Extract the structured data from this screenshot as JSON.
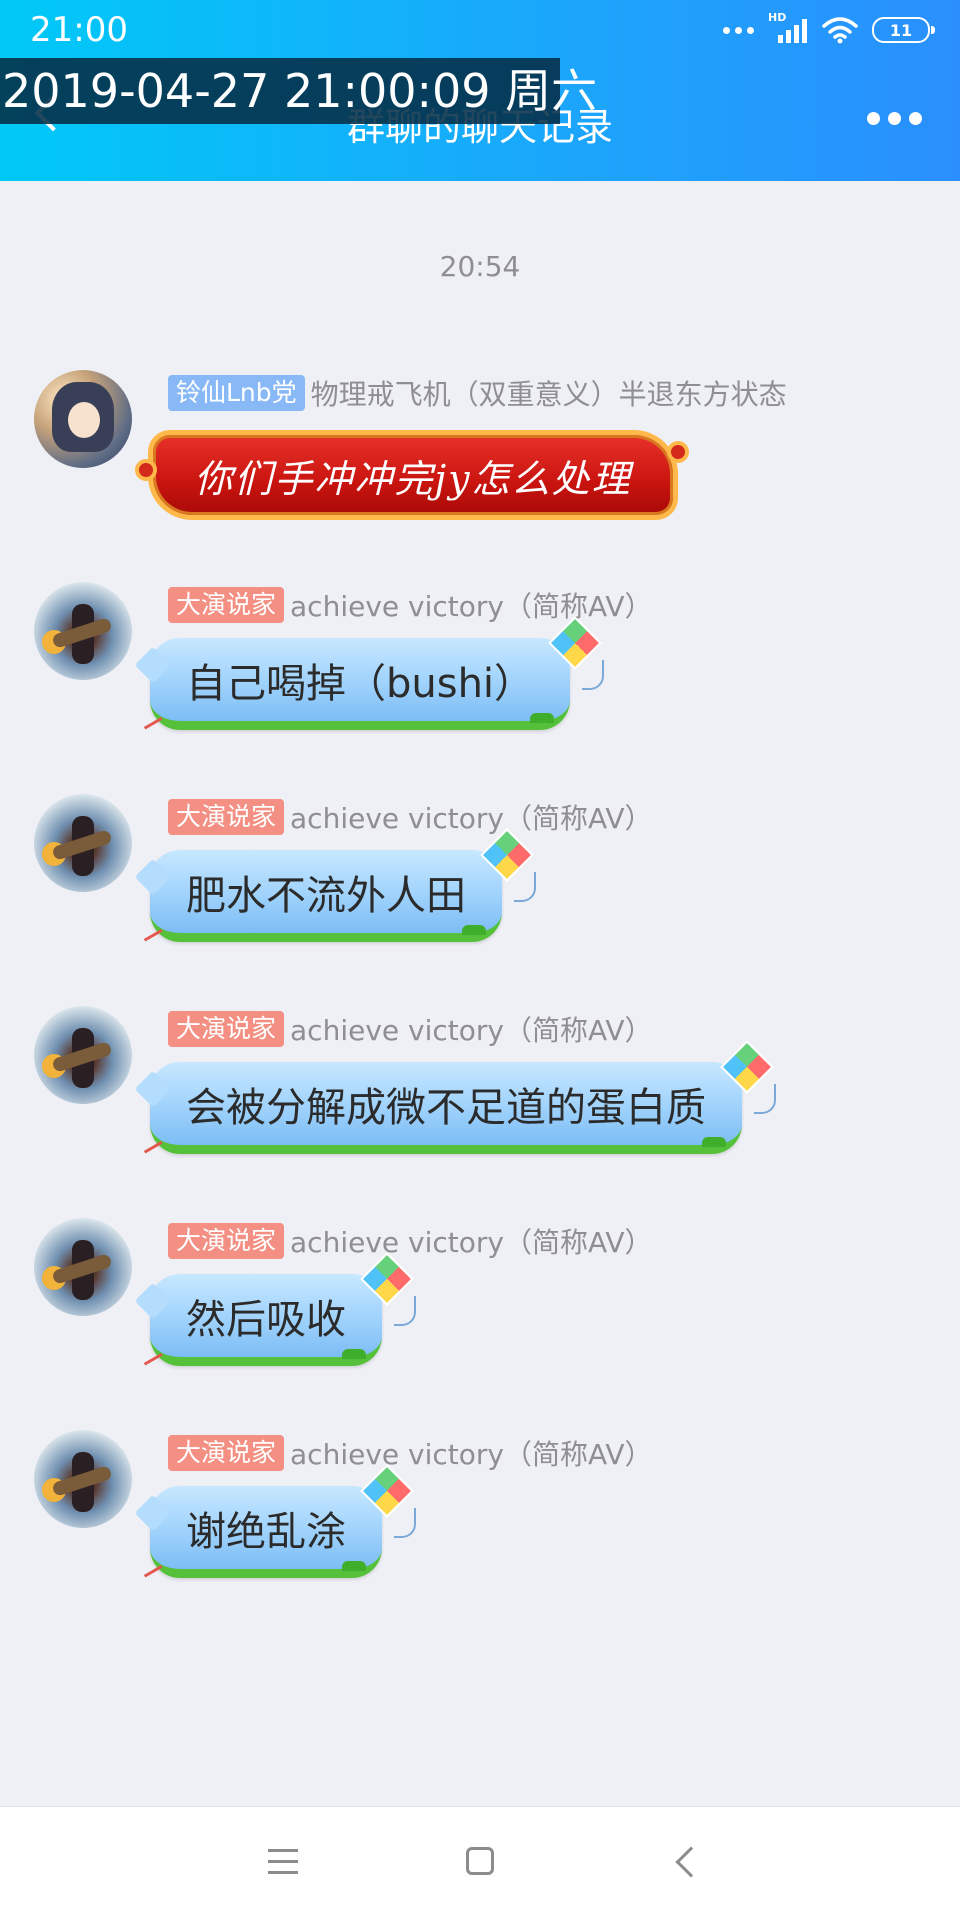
{
  "status_bar": {
    "time": "21:00",
    "network_label": "HD",
    "battery": "11",
    "icons": [
      "more-dots-icon",
      "signal-icon",
      "wifi-icon",
      "battery-icon"
    ]
  },
  "overlay": {
    "timestamp": "2019-04-27 21:00:09 周六"
  },
  "header": {
    "title": "群聊的聊天记录",
    "back_icon": "chevron-left-icon",
    "more_icon": "more-horizontal-icon"
  },
  "chat": {
    "time_divider": "20:54",
    "messages": [
      {
        "badge": "铃仙Lnb党",
        "badge_color": "#89b8f6",
        "nickname": "物理戒飞机（双重意义）半退东方状态",
        "text": "你们手冲冲完jy怎么处理",
        "bubble_style": "red-scroll"
      },
      {
        "badge": "大演说家",
        "badge_color": "#f38f83",
        "nickname": "achieve victory（简称AV）",
        "text": "自己喝掉（bushi）",
        "bubble_style": "kite"
      },
      {
        "badge": "大演说家",
        "badge_color": "#f38f83",
        "nickname": "achieve victory（简称AV）",
        "text": "肥水不流外人田",
        "bubble_style": "kite"
      },
      {
        "badge": "大演说家",
        "badge_color": "#f38f83",
        "nickname": "achieve victory（简称AV）",
        "text": "会被分解成微不足道的蛋白质",
        "bubble_style": "kite"
      },
      {
        "badge": "大演说家",
        "badge_color": "#f38f83",
        "nickname": "achieve victory（简称AV）",
        "text": "然后吸收",
        "bubble_style": "kite"
      },
      {
        "badge": "大演说家",
        "badge_color": "#f38f83",
        "nickname": "achieve victory（简称AV）",
        "text": "谢绝乱涂",
        "bubble_style": "kite"
      }
    ]
  },
  "navbar": {
    "icons": [
      "menu-icon",
      "home-icon",
      "back-icon"
    ]
  },
  "colors": {
    "header_start": "#00c9f7",
    "header_end": "#2a8ffc",
    "background": "#eff0f6"
  }
}
